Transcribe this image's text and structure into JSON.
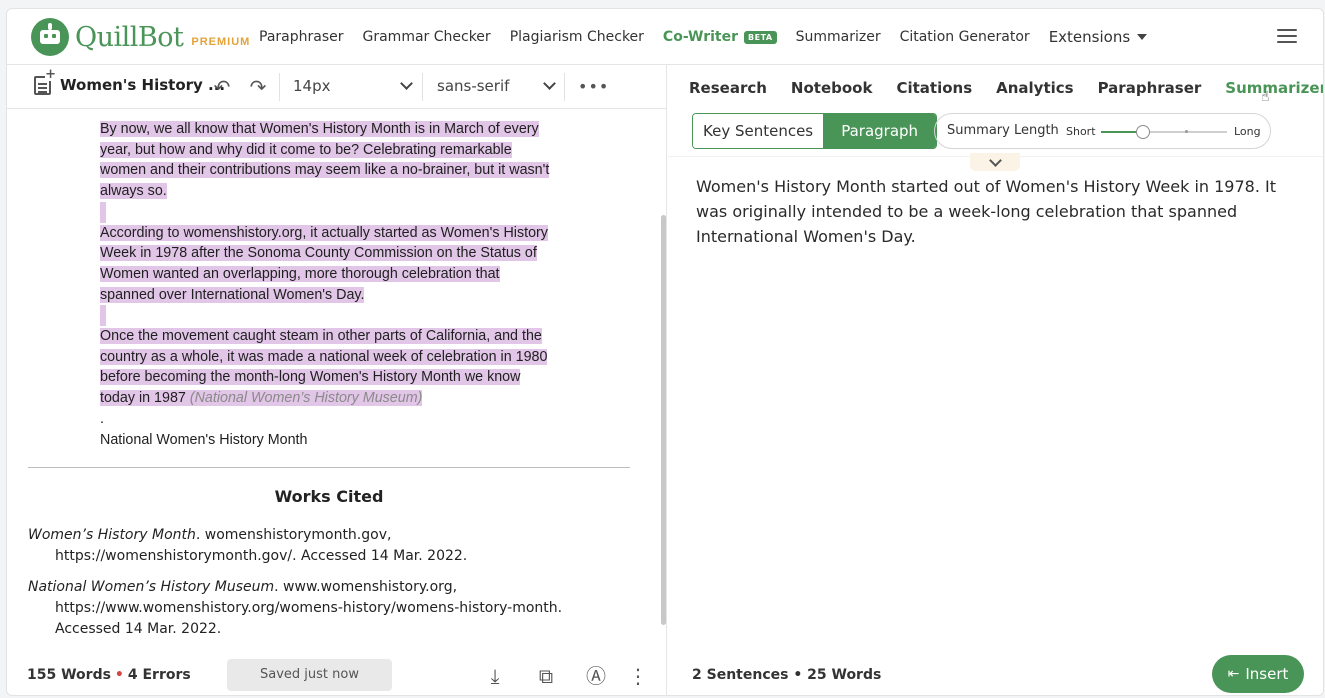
{
  "brand": {
    "name": "QuillBot",
    "tier": "PREMIUM"
  },
  "nav": {
    "items": [
      {
        "label": "Paraphraser"
      },
      {
        "label": "Grammar Checker"
      },
      {
        "label": "Plagiarism Checker"
      },
      {
        "label": "Co-Writer",
        "badge": "BETA",
        "active": true
      },
      {
        "label": "Summarizer"
      },
      {
        "label": "Citation Generator"
      },
      {
        "label": "Extensions"
      }
    ]
  },
  "toolbar": {
    "doc_title": "Women's History ...",
    "font_size": "14px",
    "font_family": "sans-serif",
    "more": "•••"
  },
  "editor": {
    "paragraphs": [
      "By now, we all know that Women's History Month is in March of every year, but how and why did it come to be? Celebrating remarkable women and their contributions may seem like a no-brainer, but it wasn't always so.",
      "According to womenshistory.org, it actually started as Women's History Week in 1978 after the Sonoma County Commission on the Status of Women wanted an overlapping, more thorough celebration that spanned over International Women's Day.",
      "Once the movement caught steam in other parts of California, and the country as a whole, it was made a national week of celebration in 1980 before becoming the month-long Women's History Month we know today in 1987"
    ],
    "inline_citation": "(National Women’s History Museum)",
    "trailing_dot": ".",
    "footer_line": "National Women's History Month"
  },
  "works_cited": {
    "title": "Works Cited",
    "entries": [
      {
        "source": "Women’s History Month",
        "rest": ". womenshistorymonth.gov, https://womenshistorymonth.gov/. Accessed 14 Mar. 2022."
      },
      {
        "source": "National Women’s History Museum",
        "rest": ". www.womenshistory.org, https://www.womenshistory.org/womens-history/womens-history-month. Accessed 14 Mar. 2022."
      }
    ]
  },
  "status": {
    "words": "155 Words",
    "separator": "•",
    "errors": "4 Errors",
    "saved": "Saved just now"
  },
  "right_panel": {
    "tabs": [
      {
        "label": "Research"
      },
      {
        "label": "Notebook"
      },
      {
        "label": "Citations"
      },
      {
        "label": "Analytics"
      },
      {
        "label": "Paraphraser"
      },
      {
        "label": "Summarizer",
        "active": true
      }
    ],
    "modes": [
      {
        "label": "Key Sentences",
        "selected": false
      },
      {
        "label": "Paragraph",
        "selected": true
      }
    ],
    "summary_length": {
      "label": "Summary Length",
      "min_label": "Short",
      "max_label": "Long",
      "value": 0.33
    },
    "summary_text": "Women's History Month started out of Women's History Week in 1978. It was originally intended to be a week-long celebration that spanned International Women's Day.",
    "stats": "2 Sentences • 25 Words",
    "insert_label": "Insert"
  },
  "colors": {
    "brand": "#499557",
    "premium": "#e3a33a",
    "highlight": "#e2c6e8",
    "error_dot": "#d64545"
  }
}
